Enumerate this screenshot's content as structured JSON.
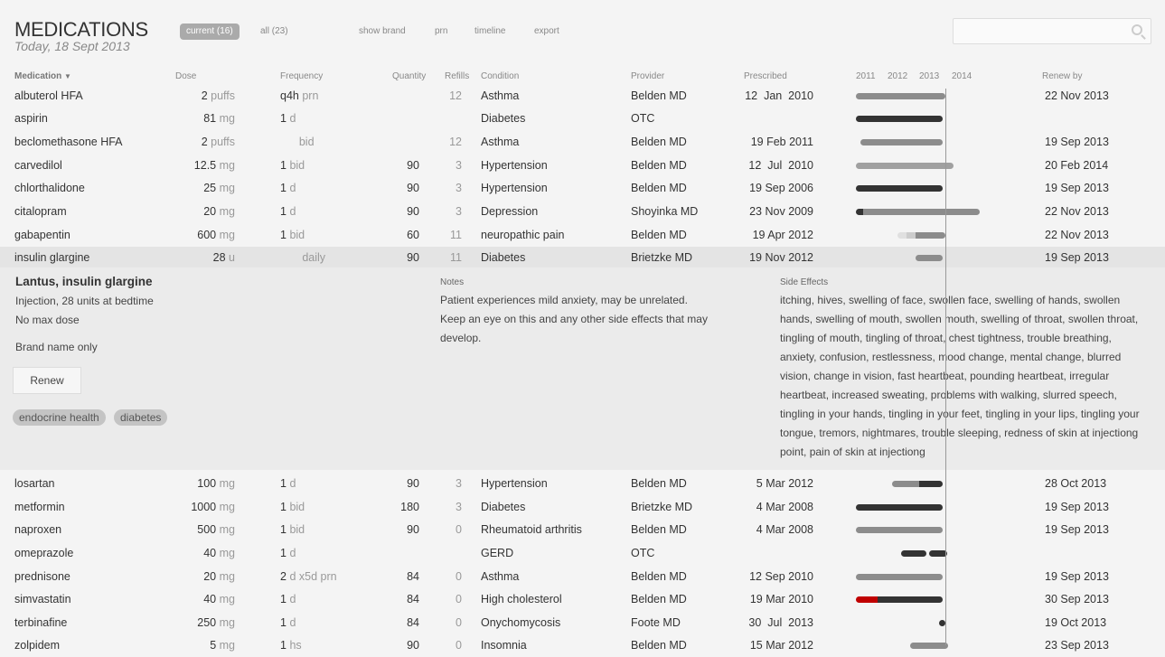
{
  "header": {
    "title": "MEDICATIONS",
    "today": "Today, 18 Sept 2013",
    "filters": [
      {
        "label": "current (16)",
        "active": true
      },
      {
        "label": "all (23)",
        "active": false
      }
    ],
    "actions": [
      "show brand",
      "prn",
      "timeline",
      "export"
    ],
    "search": {
      "placeholder": "",
      "value": ""
    }
  },
  "columns": {
    "medication": "Medication",
    "dose": "Dose",
    "frequency": "Frequency",
    "quantity": "Quantity",
    "refills": "Refills",
    "condition": "Condition",
    "provider": "Provider",
    "prescribed": "Prescribed",
    "renew": "Renew by",
    "years": [
      "2011",
      "2012",
      "2013",
      "2014"
    ]
  },
  "colors": {
    "dark": "#333333",
    "grey": "#8c8c8c",
    "light": "#a0a0a0",
    "pale": "#e0e0e0",
    "pale2": "#cccccc",
    "red": "#c00000"
  },
  "timeline": {
    "today": 2013.71
  },
  "rows": [
    {
      "name": "albuterol HFA",
      "dose": "2",
      "unit": "puffs",
      "fnum": "q4h",
      "funit": "prn",
      "qty": "",
      "refills": "12",
      "condition": "Asthma",
      "provider": "Belden MD",
      "prescribed": "12  Jan  2010",
      "renew": "22 Nov 2013",
      "bars": [
        [
          2010,
          2013.8,
          "grey"
        ]
      ]
    },
    {
      "name": "aspirin",
      "dose": "81",
      "unit": "mg",
      "fnum": "1",
      "funit": "d",
      "qty": "",
      "refills": "",
      "condition": "Diabetes",
      "provider": "OTC",
      "prescribed": "",
      "renew": "",
      "bars": [
        [
          2010,
          2013.71,
          "dark"
        ]
      ]
    },
    {
      "name": "beclomethasone HFA",
      "dose": "2",
      "unit": "puffs",
      "fnum": "",
      "funit": "     bid",
      "qty": "",
      "refills": "12",
      "condition": "Asthma",
      "provider": "Belden MD",
      "prescribed": "19 Feb 2011",
      "renew": "19 Sep 2013",
      "bars": [
        [
          2011.14,
          2013.71,
          "grey"
        ]
      ]
    },
    {
      "name": "carvedilol",
      "dose": "12.5",
      "unit": "mg",
      "fnum": "1",
      "funit": "bid",
      "qty": "90",
      "refills": "3",
      "condition": "Hypertension",
      "provider": "Belden MD",
      "prescribed": "12  Jul  2010",
      "renew": "20 Feb 2014",
      "bars": [
        [
          2010,
          2014.05,
          "light"
        ]
      ]
    },
    {
      "name": "chlorthalidone",
      "dose": "25",
      "unit": "mg",
      "fnum": "1",
      "funit": "d",
      "qty": "90",
      "refills": "3",
      "condition": "Hypertension",
      "provider": "Belden MD",
      "prescribed": "19 Sep 2006",
      "renew": "19 Sep 2013",
      "bars": [
        [
          2006,
          2013.71,
          "dark"
        ]
      ]
    },
    {
      "name": "citalopram",
      "dose": "20",
      "unit": "mg",
      "fnum": "1",
      "funit": "d",
      "qty": "90",
      "refills": "3",
      "condition": "Depression",
      "provider": "Shoyinka MD",
      "prescribed": "23 Nov 2009",
      "renew": "22 Nov 2013",
      "bars": [
        [
          2009.9,
          2011.22,
          "dark"
        ],
        [
          2011.22,
          2014.87,
          "grey"
        ]
      ]
    },
    {
      "name": "gabapentin",
      "dose": "600",
      "unit": "mg",
      "fnum": "1",
      "funit": "bid",
      "qty": "60",
      "refills": "11",
      "condition": "neuropathic pain",
      "provider": "Belden MD",
      "prescribed": "19 Apr 2012",
      "renew": "22 Nov 2013",
      "bars": [
        [
          2012.3,
          2012.57,
          "pale"
        ],
        [
          2012.57,
          2012.85,
          "pale2"
        ],
        [
          2012.85,
          2013.8,
          "grey"
        ]
      ]
    },
    {
      "name": "insulin glargine",
      "dose": "28",
      "unit": "u",
      "fnum": "",
      "funit": "      daily",
      "qty": "90",
      "refills": "11",
      "condition": "Diabetes",
      "provider": "Brietzke MD",
      "prescribed": "19 Nov 2012",
      "renew": "19 Sep 2013",
      "bars": [
        [
          2012.87,
          2013.71,
          "grey"
        ]
      ],
      "selected": true
    },
    {
      "name": "losartan",
      "dose": "100",
      "unit": "mg",
      "fnum": "1",
      "funit": "d",
      "qty": "90",
      "refills": "3",
      "condition": "Hypertension",
      "provider": "Belden MD",
      "prescribed": "5 Mar 2012",
      "renew": "28 Oct 2013",
      "bars": [
        [
          2012.12,
          2012.98,
          "grey"
        ],
        [
          2012.98,
          2013.71,
          "dark"
        ]
      ]
    },
    {
      "name": "metformin",
      "dose": "1000",
      "unit": "mg",
      "fnum": "1",
      "funit": "bid",
      "qty": "180",
      "refills": "3",
      "condition": "Diabetes",
      "provider": "Brietzke MD",
      "prescribed": "4 Mar 2008",
      "renew": "19 Sep 2013",
      "bars": [
        [
          2008,
          2013.71,
          "dark"
        ]
      ]
    },
    {
      "name": "naproxen",
      "dose": "500",
      "unit": "mg",
      "fnum": "1",
      "funit": "bid",
      "qty": "90",
      "refills": "0",
      "condition": "Rheumatoid arthritis",
      "provider": "Belden MD",
      "prescribed": "4 Mar 2008",
      "renew": "19 Sep 2013",
      "bars": [
        [
          2008,
          2013.71,
          "grey"
        ]
      ]
    },
    {
      "name": "omeprazole",
      "dose": "40",
      "unit": "mg",
      "fnum": "1",
      "funit": "d",
      "qty": "",
      "refills": "",
      "condition": "GERD",
      "provider": "OTC",
      "prescribed": "",
      "renew": "",
      "bars": [
        [
          2012.4,
          2013.2,
          "dark"
        ],
        [
          2013.28,
          2013.84,
          "dark"
        ]
      ]
    },
    {
      "name": "prednisone",
      "dose": "20",
      "unit": "mg",
      "fnum": "2",
      "funit": "d x5d prn",
      "qty": "84",
      "refills": "0",
      "condition": "Asthma",
      "provider": "Belden MD",
      "prescribed": "12 Sep 2010",
      "renew": "19 Sep 2013",
      "bars": [
        [
          2010.7,
          2013.71,
          "grey"
        ]
      ]
    },
    {
      "name": "simvastatin",
      "dose": "40",
      "unit": "mg",
      "fnum": "1",
      "funit": "d",
      "qty": "84",
      "refills": "0",
      "condition": "High cholesterol",
      "provider": "Belden MD",
      "prescribed": "19 Mar 2010",
      "renew": "30 Sep 2013",
      "bars": [
        [
          2010.2,
          2011.68,
          "red"
        ],
        [
          2011.68,
          2013.71,
          "dark"
        ]
      ]
    },
    {
      "name": "terbinafine",
      "dose": "250",
      "unit": "mg",
      "fnum": "1",
      "funit": "d",
      "qty": "84",
      "refills": "0",
      "condition": "Onychomycosis",
      "provider": "Foote MD",
      "prescribed": "30  Jul  2013",
      "renew": "19 Oct 2013",
      "bars": [
        [
          2013.58,
          2013.8,
          "dark"
        ]
      ]
    },
    {
      "name": "zolpidem",
      "dose": "5",
      "unit": "mg",
      "fnum": "1",
      "funit": "hs",
      "qty": "90",
      "refills": "0",
      "condition": "Insomnia",
      "provider": "Belden MD",
      "prescribed": "15 Mar 2012",
      "renew": "23 Sep 2013",
      "bars": [
        [
          2012.7,
          2013.87,
          "grey"
        ]
      ]
    }
  ],
  "detail": {
    "title": "Lantus, insulin glargine",
    "lines": [
      "Injection, 28 units at bedtime",
      "No max dose"
    ],
    "brand": "Brand name only",
    "renew_label": "Renew",
    "tags": [
      "endocrine health",
      "diabetes"
    ],
    "notes_label": "Notes",
    "notes": "Patient experiences mild anxiety, may be unrelated. Keep an eye on this and any other side effects that may develop.",
    "side_label": "Side Effects",
    "side_effects": "itching, hives, swelling of face, swollen face, swelling of hands, swollen hands, swelling of mouth, swollen mouth, swelling of throat, swollen throat, tingling of mouth, tingling of throat, chest tightness, trouble breathing, anxiety, confusion, restlessness, mood change, mental change, blurred vision, change in vision, fast heartbeat, pounding heartbeat, irregular heartbeat, increased sweating, problems with walking, slurred speech, tingling in your hands, tingling in your feet, tingling in your lips, tingling your tongue, tremors, nightmares, trouble sleeping, redness of skin at injectiong point, pain of skin at injectiong"
  }
}
